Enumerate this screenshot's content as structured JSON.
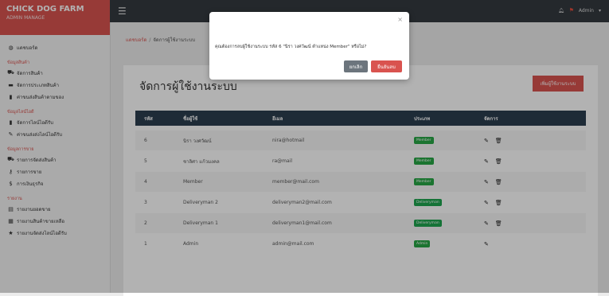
{
  "brand": {
    "title": "CHICK DOG FARM",
    "subtitle": "ADMIN MANAGE"
  },
  "topbar": {
    "menu_icon": "hamburger-icon",
    "admin_label": "Admin"
  },
  "sidebar": {
    "dashboard": "แดชบอร์ด",
    "sections": [
      {
        "heading": "ข้อมูลสินค้า",
        "items": [
          "จัดการสินค้า",
          "จัดการประเภทสินค้า",
          "ค่าขนส่งสินค้าตามของ"
        ]
      },
      {
        "heading": "ข้อมูลไลน์ไอดี",
        "items": [
          "จัดการไลน์ไอดีรับ",
          "ค่าขนส่งส่งไลน์ไอดีรับ"
        ]
      },
      {
        "heading": "ข้อมูลการขาย",
        "items": [
          "รายการจัดส่งสินค้า",
          "รายการขาย",
          "การเงินธุรกิจ"
        ]
      },
      {
        "heading": "รายงาน",
        "items": [
          "รายงานยอดขาย",
          "รายงานสินค้าขายเหลือ",
          "รายงานจัดส่งไลน์ไอดีรับ"
        ]
      }
    ]
  },
  "breadcrumb": {
    "home": "แดชบอร์ด",
    "current": "จัดการผู้ใช้งานระบบ"
  },
  "page": {
    "title": "จัดการผู้ใช้งานระบบ",
    "add_button": "เพิ่มผู้ใช้งานระบบ"
  },
  "table": {
    "headers": [
      "รหัส",
      "ชื่อผู้ใช้",
      "อีเมล",
      "ประเภท",
      "จัดการ"
    ],
    "rows": [
      {
        "id": "6",
        "name": "นิรา วงศวัฒน์",
        "email": "nira@hotmail",
        "type": "Member"
      },
      {
        "id": "5",
        "name": "ชาลิศา แก้วมงคล",
        "email": "ra@mail",
        "type": "Member"
      },
      {
        "id": "4",
        "name": "Member",
        "email": "member@mail.com",
        "type": "Member"
      },
      {
        "id": "3",
        "name": "Deliveryman 2",
        "email": "deliveryman2@mail.com",
        "type": "Deliveryman"
      },
      {
        "id": "2",
        "name": "Deliveryman 1",
        "email": "deliveryman1@mail.com",
        "type": "Deliveryman"
      },
      {
        "id": "1",
        "name": "Admin",
        "email": "admin@mail.com",
        "type": "Admin"
      }
    ]
  },
  "modal": {
    "message": "คุณต้องการลบผู้ใช้งานระบบ รหัส 6 \"นิรา วงศวัฒน์ ตำแหน่ง Member\" หรือไม่?",
    "cancel": "ยกเลิก",
    "confirm": "ยืนยันลบ"
  },
  "colors": {
    "accent": "#d9534f",
    "topbar": "#343a40",
    "table_header": "#2c3e50",
    "badge": "#28a745"
  }
}
